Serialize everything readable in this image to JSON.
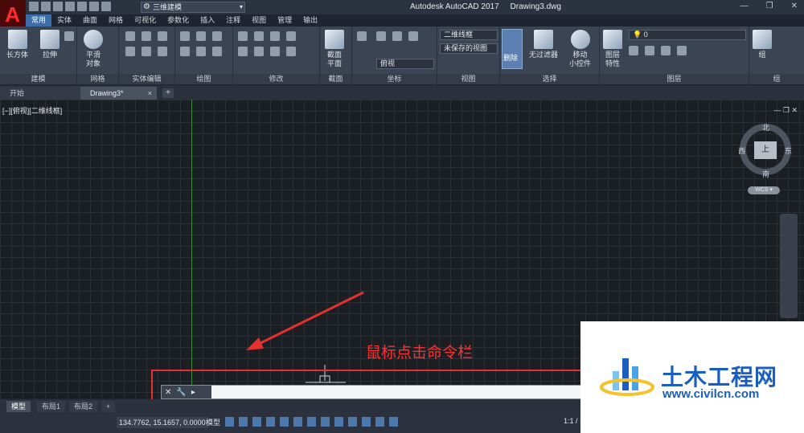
{
  "titlebar": {
    "app_title": "Autodesk AutoCAD 2017",
    "doc_title": "Drawing3.dwg",
    "workspace": "三维建模",
    "logo_letter": "A",
    "minimize": "—",
    "restore": "❐",
    "close": "✕"
  },
  "menu_tabs": [
    "常用",
    "实体",
    "曲面",
    "网格",
    "可视化",
    "参数化",
    "插入",
    "注释",
    "视图",
    "管理",
    "输出"
  ],
  "ribbon": {
    "box_label": "长方体",
    "extrude_label": "拉伸",
    "smooth_label_1": "平滑",
    "smooth_label_2": "对象",
    "section_label_1": "截面",
    "section_label_2": "平面",
    "visual_style": "二维线框",
    "saved_view": "未保存的视图",
    "view_combo": "俯视",
    "delete_label": "删除",
    "filter_label": "无过滤器",
    "gizmo_label_1": "移动",
    "gizmo_label_2": "小控件",
    "layer_prop_1": "图层",
    "layer_prop_2": "特性",
    "layer_combo": "0",
    "group_label": "组",
    "panels": {
      "modeling": "建模",
      "mesh": "网格",
      "solid_edit": "实体编辑",
      "draw": "绘图",
      "modify": "修改",
      "section": "截面",
      "coordinates": "坐标",
      "view": "视图",
      "selection": "选择",
      "layers": "图层",
      "groups": "组"
    }
  },
  "file_tabs": {
    "start": "开始",
    "doc": "Drawing3*",
    "close": "×",
    "add": "+"
  },
  "viewport": {
    "label": "[−][俯视][二维线框]",
    "controls": "— ❐ ✕",
    "compass": {
      "north": "北",
      "south": "南",
      "east": "东",
      "west": "西",
      "top": "上"
    },
    "wcs": "WCS ▾"
  },
  "annotation": {
    "text": "鼠标点击命令栏",
    "color": "#ff3030"
  },
  "command_line": {
    "close": "✕",
    "tool": "🔧",
    "prompt": "▸",
    "value": ""
  },
  "layout_tabs": [
    "模型",
    "布局1",
    "布局2",
    "+"
  ],
  "status": {
    "coords": "134.7762, 15.1657, 0.0000",
    "model": "模型",
    "scale": "1:1 / 1"
  },
  "watermark": {
    "title": "土木工程网",
    "url": "www.civilcn.com"
  },
  "colors": {
    "accent": "#3b6ea8",
    "grid_bg": "#1b1e22",
    "annotation_red": "#e53030",
    "watermark_blue": "#1a5fbf"
  }
}
